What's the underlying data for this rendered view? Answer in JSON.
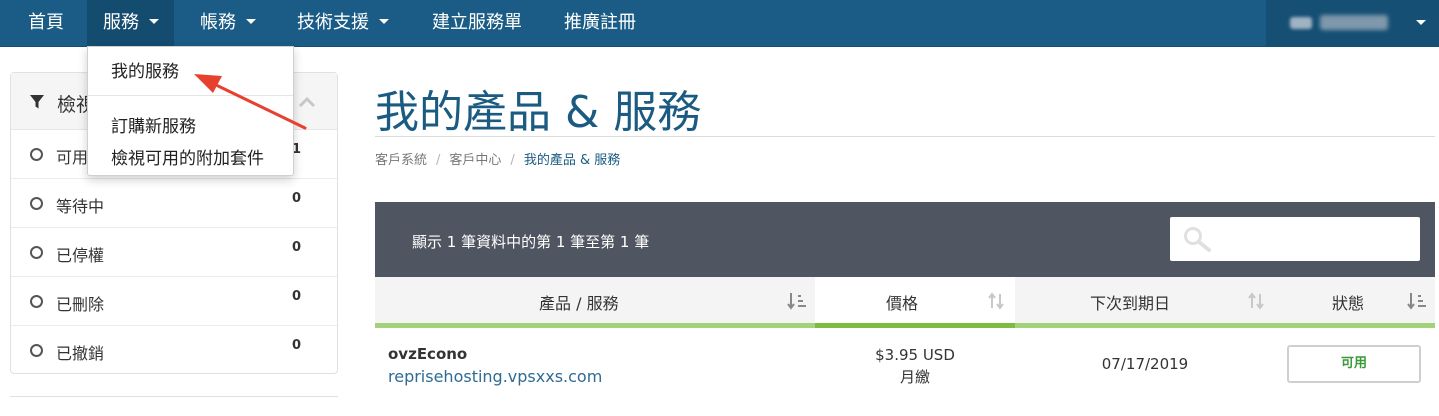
{
  "nav": {
    "home": "首頁",
    "services": "服務",
    "billing": "帳務",
    "support": "技術支援",
    "open_ticket": "建立服務單",
    "affiliates": "推廣註冊"
  },
  "dropdown": {
    "my_services": "我的服務",
    "order_new": "訂購新服務",
    "view_addons": "檢視可用的附加套件"
  },
  "sidebar": {
    "title": "檢視",
    "filters": [
      {
        "label": "可用",
        "count": "1"
      },
      {
        "label": "等待中",
        "count": "0"
      },
      {
        "label": "已停權",
        "count": "0"
      },
      {
        "label": "已刪除",
        "count": "0"
      },
      {
        "label": "已撤銷",
        "count": "0"
      }
    ]
  },
  "page": {
    "title": "我的產品 & 服務",
    "breadcrumb": [
      "客戶系統",
      "客戶中心",
      "我的產品 & 服務"
    ],
    "breadcrumb_sep": "/"
  },
  "table": {
    "info": "顯示 1 筆資料中的第 1 筆至第 1 筆",
    "search_placeholder": "",
    "columns": [
      "產品 / 服務",
      "價格",
      "下次到期日",
      "狀態"
    ],
    "rows": [
      {
        "product": "ovzEcono",
        "domain": "reprisehosting.vpsxxs.com",
        "price": "$3.95 USD",
        "cycle": "月繳",
        "due": "07/17/2019",
        "status": "可用"
      }
    ]
  },
  "colors": {
    "nav_bg": "#1a5c85",
    "title": "#1b5b82",
    "table_bar": "#505661",
    "sort_bar": "#a3d27a",
    "sort_bar_active": "#7cbb44",
    "status_active": "#3a9a3a",
    "annotation": "#e8402f"
  },
  "icons": [
    "filter-icon",
    "chevron-up-icon",
    "search-icon",
    "sort-icon",
    "chevron-down-icon",
    "annotation-arrow"
  ]
}
